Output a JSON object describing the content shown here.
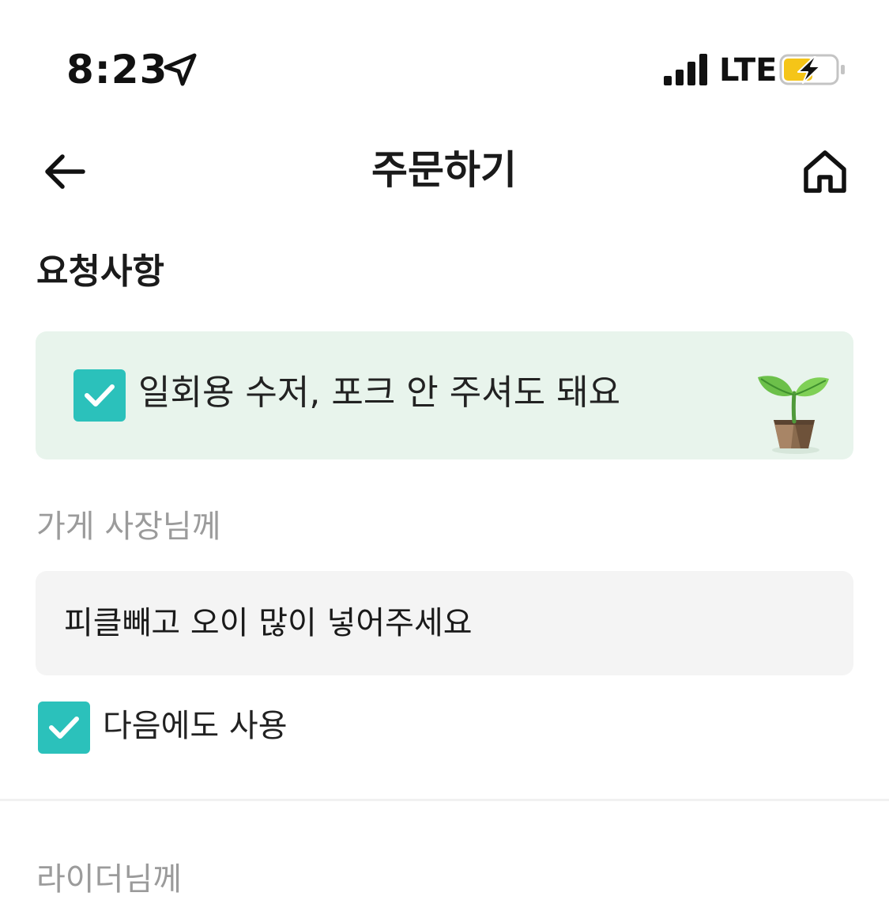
{
  "status_bar": {
    "time": "8:23",
    "network": "LTE",
    "icons": [
      "location-arrow-icon",
      "signal-bars-icon",
      "battery-charging-icon"
    ],
    "battery_color": "#f5c518"
  },
  "header": {
    "title": "주문하기",
    "back_icon": "back-arrow-icon",
    "home_icon": "home-icon"
  },
  "requests": {
    "section_title": "요청사항",
    "no_cutlery": {
      "label": "일회용 수저, 포크 안 주셔도 돼요",
      "checked": true,
      "icon": "plant-sprout-icon",
      "background": "#e8f4ec"
    },
    "store": {
      "label": "가게 사장님께",
      "value": "피클빼고 오이 많이 넣어주세요",
      "reuse_label": "다음에도 사용",
      "reuse_checked": true
    },
    "rider": {
      "label": "라이더님께"
    }
  },
  "colors": {
    "accent": "#2bc1bb",
    "muted_text": "#9b9b9b",
    "field_background": "#f4f4f4"
  }
}
